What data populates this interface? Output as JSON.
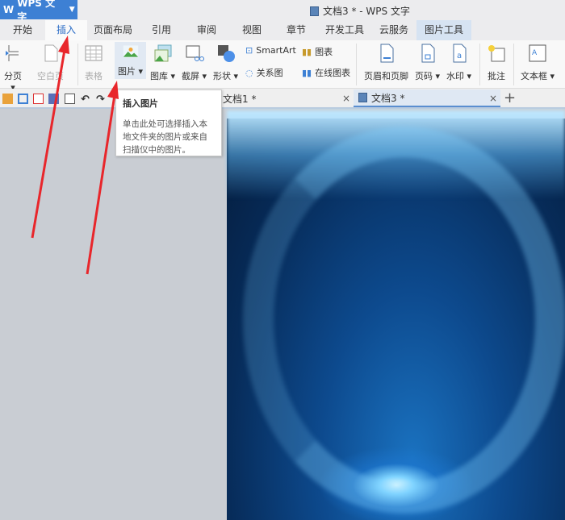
{
  "app": {
    "name": "WPS 文字",
    "title": "文档3 * - WPS 文字"
  },
  "tabs": [
    "开始",
    "插入",
    "页面布局",
    "引用",
    "审阅",
    "视图",
    "章节",
    "开发工具",
    "云服务",
    "图片工具"
  ],
  "ribbon": {
    "page_break": "分页",
    "blank_page": "空白页",
    "table": "表格",
    "picture": "图片",
    "gallery": "图库",
    "screenshot": "截屏",
    "shape": "形状",
    "smartart": "SmartArt",
    "relation": "关系图",
    "chart": "图表",
    "online_chart": "在线图表",
    "header_footer": "页眉和页脚",
    "page_num": "页码",
    "watermark": "水印",
    "comment": "批注",
    "textbox": "文本框"
  },
  "doc_tabs": [
    {
      "label": "文档1 *"
    },
    {
      "label": "文档3 *"
    }
  ],
  "tooltip": {
    "title": "插入图片",
    "body": "单击此处可选择插入本地文件夹的图片或来自扫描仪中的图片。"
  },
  "colors": {
    "accent": "#3d80d4",
    "arrow": "#e8262b"
  }
}
